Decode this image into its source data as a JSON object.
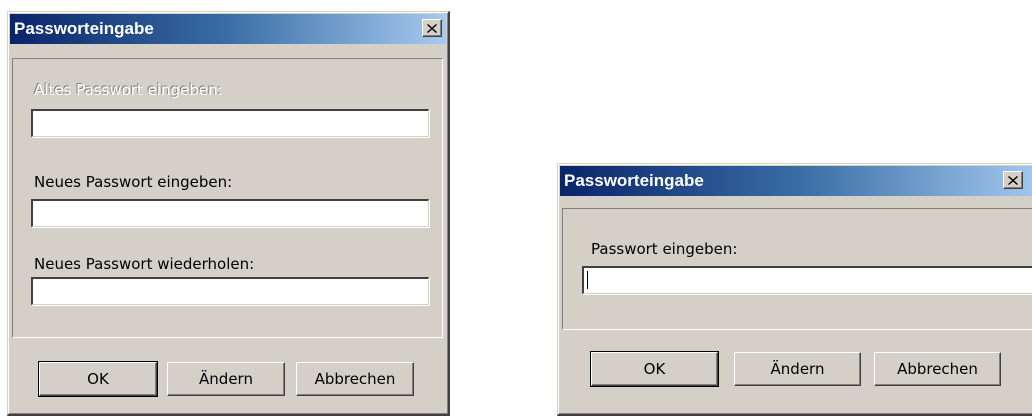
{
  "dialog_change": {
    "title": "Passworteingabe",
    "old_password_label": "Altes Passwort eingeben:",
    "old_password_value": "",
    "new_password_label": "Neues Passwort eingeben:",
    "new_password_value": "",
    "repeat_password_label": "Neues Passwort wiederholen:",
    "repeat_password_value": "",
    "ok_label": "OK",
    "change_label": "Ändern",
    "cancel_label": "Abbrechen"
  },
  "dialog_enter": {
    "title": "Passworteingabe",
    "password_label": "Passwort eingeben:",
    "password_value": "",
    "ok_label": "OK",
    "change_label": "Ändern",
    "cancel_label": "Abbrechen"
  },
  "icons": {
    "close": "close-x-icon"
  },
  "colors": {
    "title_start": "#0a246a",
    "title_end": "#a6caf0",
    "face": "#d4d0c8"
  }
}
